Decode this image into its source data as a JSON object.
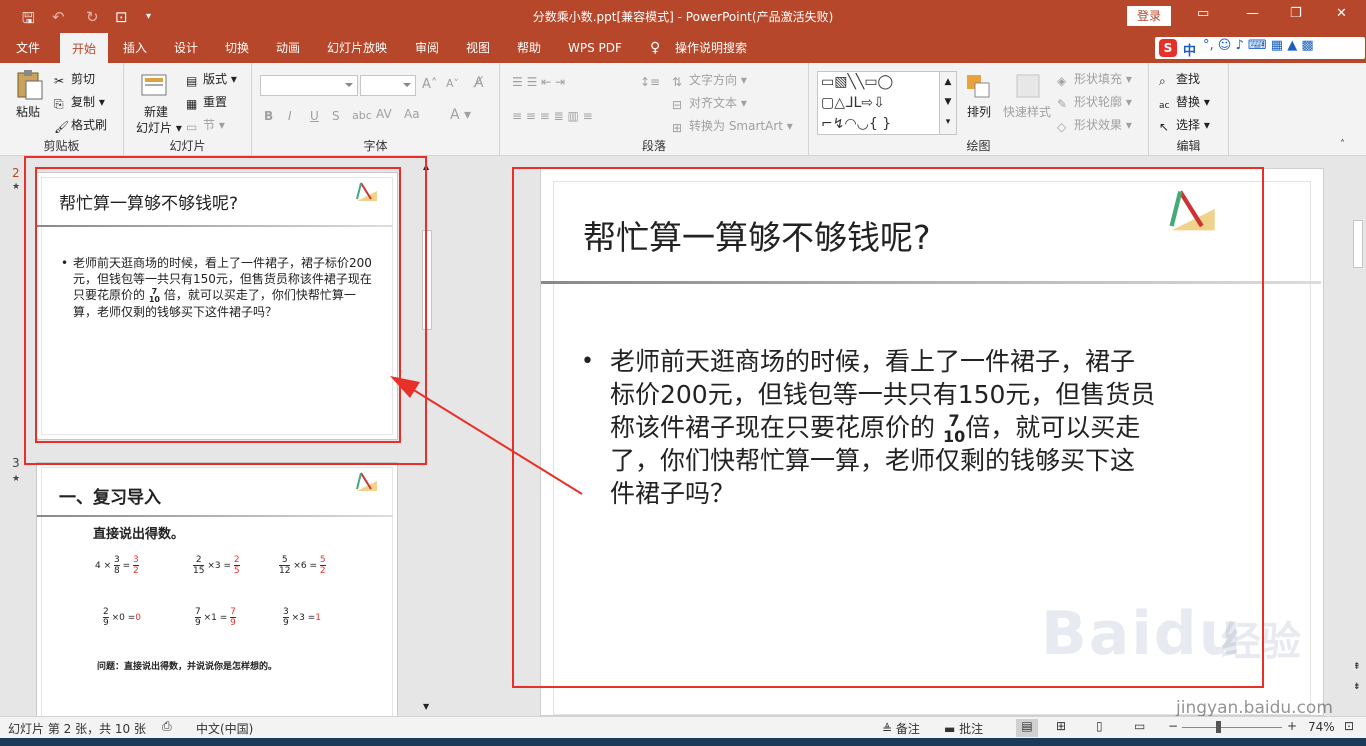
{
  "titlebar": {
    "title": "分数乘小数.ppt[兼容模式]  -  PowerPoint(产品激活失败)",
    "login": "登录"
  },
  "tabs": [
    "文件",
    "开始",
    "插入",
    "设计",
    "切换",
    "动画",
    "幻灯片放映",
    "审阅",
    "视图",
    "帮助",
    "WPS PDF",
    "操作说明搜索"
  ],
  "ime": {
    "label": "中"
  },
  "ribbon": {
    "clipboard": {
      "label": "剪贴板",
      "paste": "粘贴",
      "cut": "剪切",
      "copy": "复制",
      "format_painter": "格式刷"
    },
    "slides": {
      "label": "幻灯片",
      "new_slide": "新建",
      "new_slide2": "幻灯片",
      "layout": "版式",
      "reset": "重置",
      "section": "节"
    },
    "font": {
      "label": "字体",
      "bold": "B",
      "italic": "I",
      "underline": "U",
      "strike": "S"
    },
    "paragraph": {
      "label": "段落",
      "text_dir": "文字方向",
      "align_text": "对齐文本",
      "smartart": "转换为 SmartArt"
    },
    "drawing": {
      "label": "绘图",
      "arrange": "排列",
      "quick_styles": "快速样式",
      "shape_fill": "形状填充",
      "shape_outline": "形状轮廓",
      "shape_effects": "形状效果"
    },
    "editing": {
      "label": "编辑",
      "find": "查找",
      "replace": "替换",
      "select": "选择"
    }
  },
  "thumbs": [
    {
      "num": "2",
      "star": "★",
      "title": "帮忙算一算够不够钱呢?",
      "body_pre": "老师前天逛商场的时候，看上了一件裙子，裙子标价200元，但钱包等一共只有150元，但售货员称该件裙子现在只要花原价的",
      "frac_num": "7",
      "frac_den": "10",
      "body_post": "倍，就可以买走了，你们快帮忙算一算，老师仅剩的钱够买下这件裙子吗？"
    },
    {
      "num": "3",
      "star": "★",
      "title": "一、复习导入",
      "subtitle": "直接说出得数。",
      "question": "问题：直接说出得数，并说说你是怎样想的。"
    }
  ],
  "math": {
    "r1": [
      {
        "a": "4 ×",
        "n": "3",
        "d": "8",
        "eq": "=",
        "rn": "3",
        "rd": "2"
      },
      {
        "n": "2",
        "d": "15",
        "a": "×3 =",
        "rn": "2",
        "rd": "5"
      },
      {
        "n": "5",
        "d": "12",
        "a": "×6 =",
        "rn": "5",
        "rd": "2"
      }
    ],
    "r2": [
      {
        "n": "2",
        "d": "9",
        "a": "×0  =",
        "r": "0"
      },
      {
        "n": "7",
        "d": "9",
        "a": "×1 =",
        "rn": "7",
        "rd": "9"
      },
      {
        "n": "3",
        "d": "9",
        "a": "×3  =",
        "r": "1"
      }
    ]
  },
  "slide": {
    "title": "帮忙算一算够不够钱呢?",
    "line1": "老师前天逛商场的时候，看上了一件裙子，裙子",
    "line2": "标价200元，但钱包等一共只有150元，但售货员",
    "line3a": "称该件裙子现在只要花原价的",
    "frac_num": "7",
    "frac_den": "10",
    "line3b": "倍，就可以买走",
    "line4": "了，你们快帮忙算一算，老师仅剩的钱够买下这",
    "line5": "件裙子吗？"
  },
  "watermark": {
    "brand": "Baidu",
    "brand2": "经验",
    "url": "jingyan.baidu.com"
  },
  "status": {
    "slide_info": "幻灯片 第 2 张，共 10 张",
    "lang": "中文(中国)",
    "notes": "备注",
    "comments": "批注",
    "zoom": "74%"
  }
}
